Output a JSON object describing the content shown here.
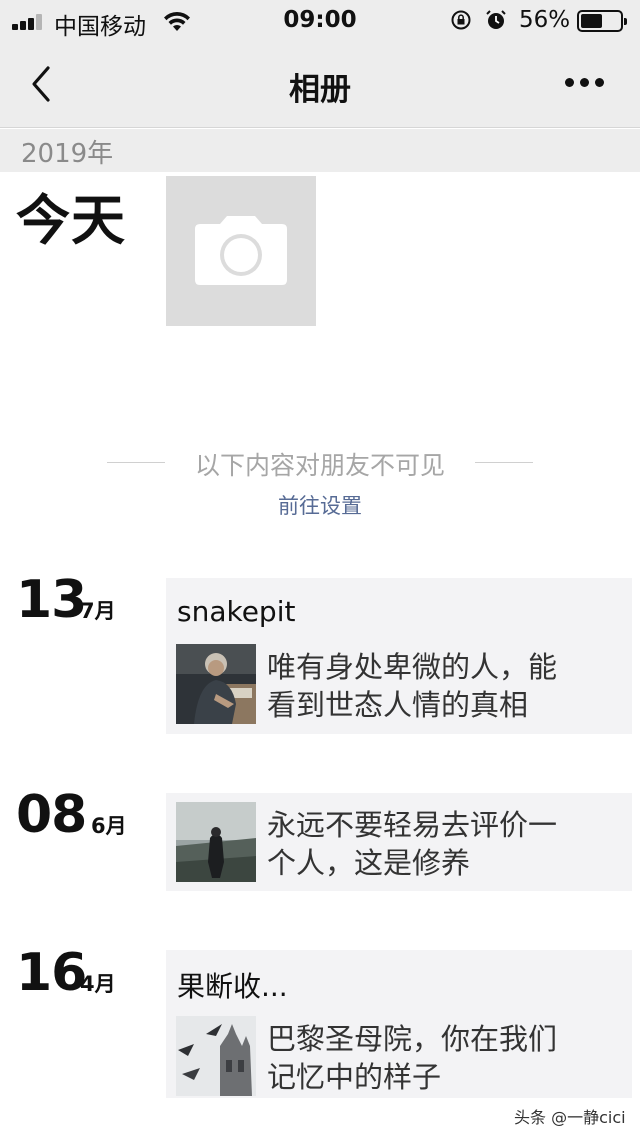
{
  "status_bar": {
    "carrier": "中国移动",
    "time": "09:00",
    "battery": "56%",
    "battery_level": 0.56,
    "icons": [
      "signal-icon",
      "wifi-icon",
      "rotation-lock-icon",
      "alarm-icon",
      "battery-icon"
    ]
  },
  "nav": {
    "title": "相册",
    "back_icon": "chevron-left-icon",
    "more_icon": "more-dots-icon"
  },
  "year": "2019年",
  "today": {
    "label": "今天",
    "add_icon": "camera-icon"
  },
  "privacy": {
    "notice": "以下内容对朋友不可见",
    "link": "前往设置"
  },
  "posts": [
    {
      "day": "13",
      "month": "7月",
      "title": "snakepit",
      "text_lines": [
        "唯有身处卑微的人，能",
        "看到世态人情的真相"
      ]
    },
    {
      "day": "08",
      "month": "6月",
      "title": "",
      "text_lines": [
        "永远不要轻易去评价一",
        "个人，这是修养"
      ]
    },
    {
      "day": "16",
      "month": "4月",
      "title": "果断收...",
      "text_lines": [
        "巴黎圣母院，你在我们",
        "记忆中的样子"
      ]
    }
  ],
  "watermark": "头条 @一静cici",
  "colors": {
    "bar_bg": "#ededed",
    "card_bg": "#f3f3f5",
    "link": "#576b95",
    "muted": "#a6a6a6"
  }
}
